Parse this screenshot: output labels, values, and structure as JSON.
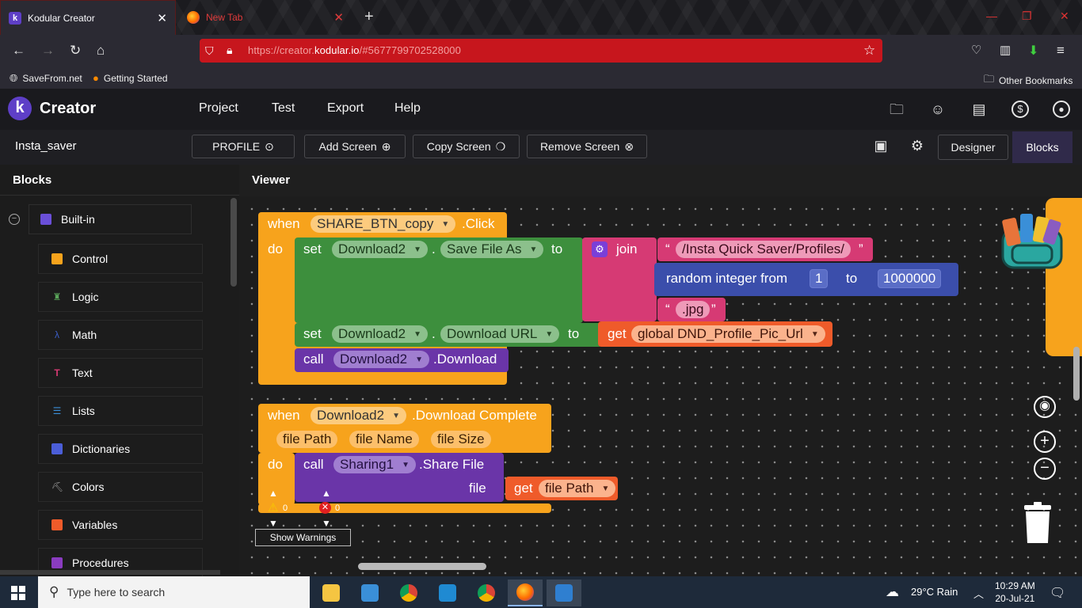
{
  "browser": {
    "tabs": [
      {
        "title": "Kodular Creator",
        "active": true
      },
      {
        "title": "New Tab",
        "active": false
      }
    ],
    "url_prefix": "https://creator.",
    "url_domain": "kodular.io",
    "url_suffix": "/#5677799702528000",
    "bookmarks": [
      "SaveFrom.net",
      "Getting Started"
    ],
    "other_bookmarks": "Other Bookmarks"
  },
  "app": {
    "name": "Creator",
    "menu": [
      "Project",
      "Test",
      "Export",
      "Help"
    ],
    "project_name": "Insta_saver",
    "screen_selector": "PROFILE",
    "buttons": {
      "add_screen": "Add Screen",
      "copy_screen": "Copy Screen",
      "remove_screen": "Remove Screen",
      "designer": "Designer",
      "blocks": "Blocks"
    }
  },
  "left_panel": {
    "title": "Blocks",
    "builtin": "Built-in",
    "categories": [
      {
        "label": "Control",
        "color": "#f7a31c"
      },
      {
        "label": "Logic",
        "color": "#5aa65a"
      },
      {
        "label": "Math",
        "color": "#3b5ec6"
      },
      {
        "label": "Text",
        "color": "#d63a74"
      },
      {
        "label": "Lists",
        "color": "#3b8fd8"
      },
      {
        "label": "Dictionaries",
        "color": "#4b5ed8"
      },
      {
        "label": "Colors",
        "color": "#9a9a9a"
      },
      {
        "label": "Variables",
        "color": "#ef5b2a"
      },
      {
        "label": "Procedures",
        "color": "#8a3cc0"
      }
    ]
  },
  "viewer": {
    "title": "Viewer",
    "block1": {
      "when": "when",
      "component": "SHARE_BTN_copy",
      "event": ".Click",
      "do": "do",
      "set1": {
        "kw": "set",
        "comp": "Download2",
        "dot": ".",
        "prop": "Save File As",
        "to": "to"
      },
      "join": "join",
      "quote_open": "“",
      "quote_close": "”",
      "text1": "/Insta Quick Saver/Profiles/",
      "random": "random integer from",
      "random_from": "1",
      "random_to_kw": "to",
      "random_to": "1000000",
      "text2": ".jpg",
      "set2": {
        "kw": "set",
        "comp": "Download2",
        "dot": ".",
        "prop": "Download URL",
        "to": "to"
      },
      "get_kw": "get",
      "get_var": "global DND_Profile_Pic_Url",
      "call_kw": "call",
      "call_comp": "Download2",
      "call_method": ".Download"
    },
    "block2": {
      "when": "when",
      "component": "Download2",
      "event": ".Download Complete",
      "params": [
        "file Path",
        "file Name",
        "file Size"
      ],
      "do": "do",
      "call_kw": "call",
      "call_comp": "Sharing1",
      "call_method": ".Share File",
      "arg_label": "file",
      "get_kw": "get",
      "get_var": "file Path"
    },
    "warnings_count": "0",
    "errors_count": "0",
    "show_warnings": "Show Warnings"
  },
  "taskbar": {
    "search_placeholder": "Type here to search",
    "weather": "29°C  Rain",
    "time": "10:29 AM",
    "date": "20-Jul-21"
  }
}
